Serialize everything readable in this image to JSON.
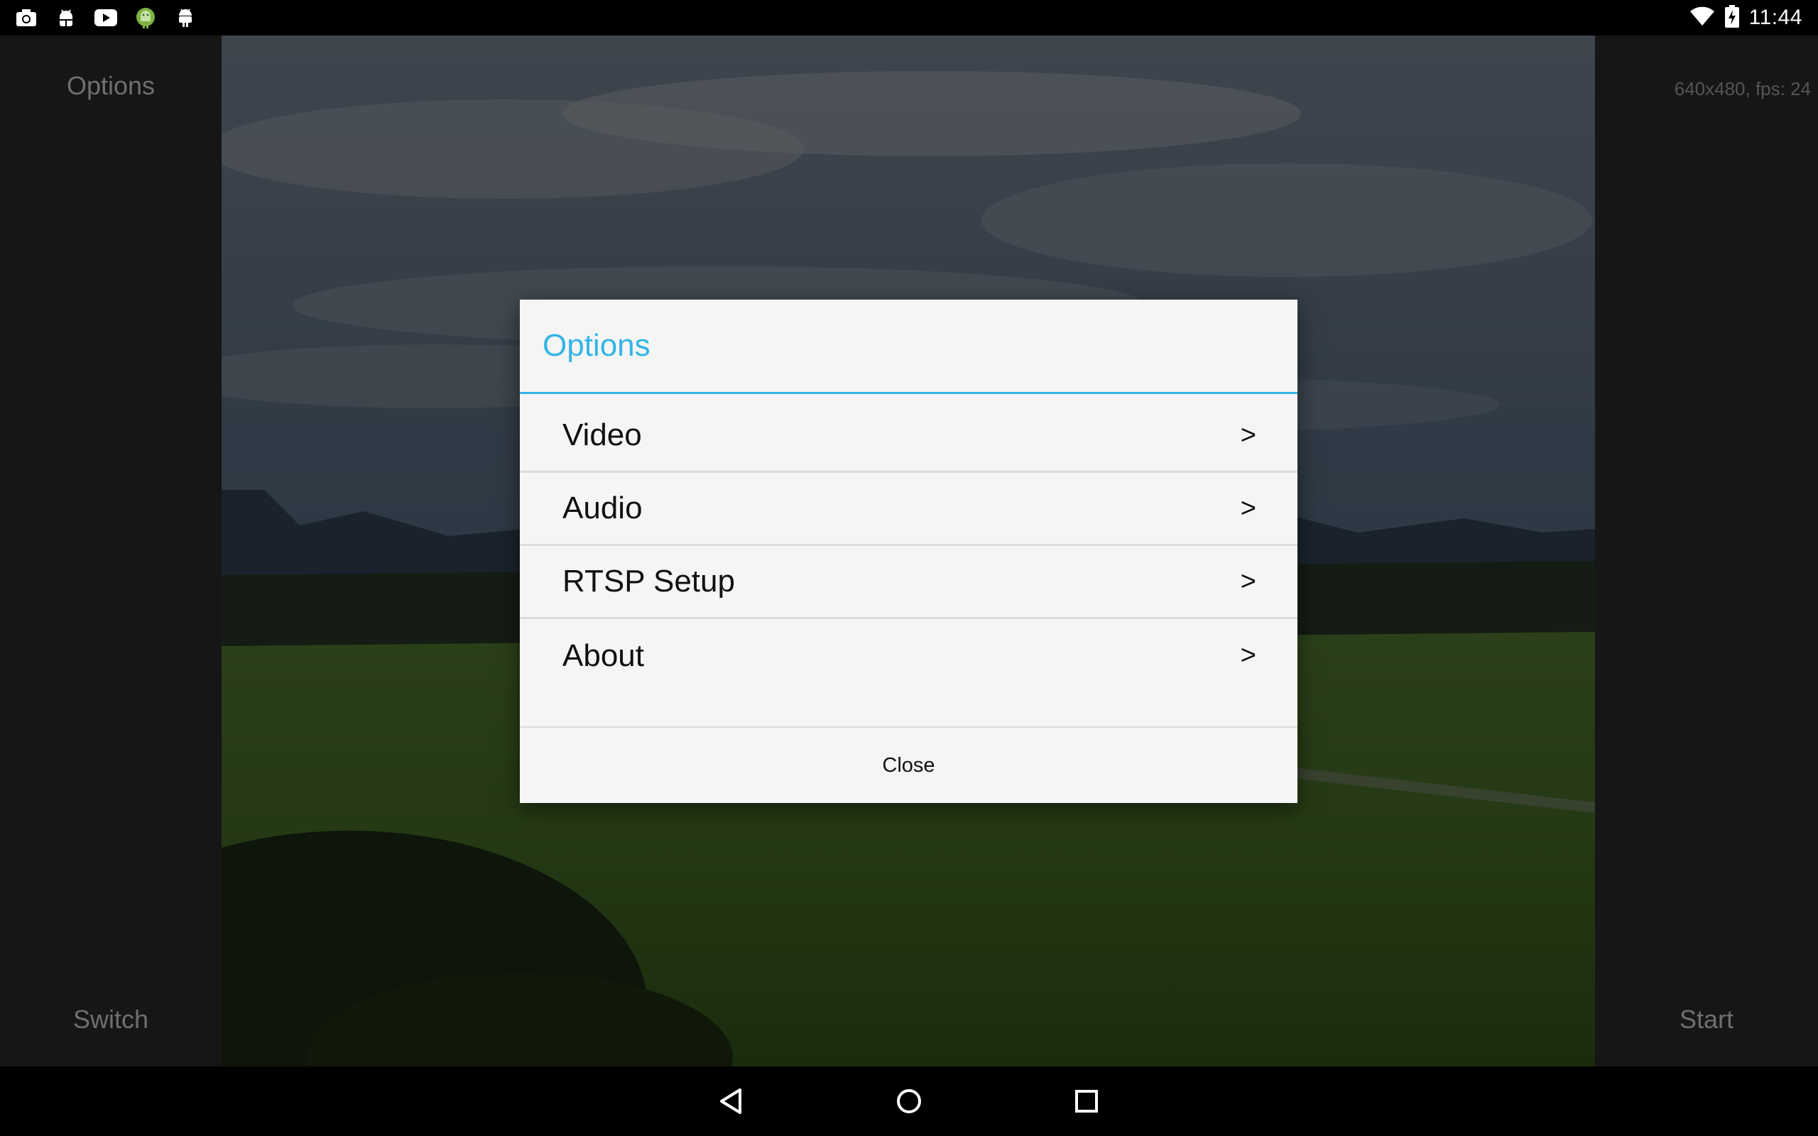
{
  "status_bar": {
    "time": "11:44",
    "left_icons": [
      "camera-icon",
      "android-debug-icon",
      "youtube-icon",
      "android-green-icon",
      "android-small-icon"
    ],
    "right_icons": [
      "wifi-icon",
      "battery-charging-icon"
    ]
  },
  "left_panel": {
    "options_label": "Options",
    "switch_label": "Switch"
  },
  "right_panel": {
    "resolution_info": "640x480, fps: 24",
    "start_label": "Start"
  },
  "dialog": {
    "title": "Options",
    "items": [
      {
        "label": "Video",
        "chevron": ">"
      },
      {
        "label": "Audio",
        "chevron": ">"
      },
      {
        "label": "RTSP Setup",
        "chevron": ">"
      },
      {
        "label": "About",
        "chevron": ">"
      }
    ],
    "close_label": "Close"
  },
  "nav_bar": {
    "buttons": [
      "back-icon",
      "home-icon",
      "recents-icon"
    ]
  },
  "colors": {
    "accent": "#33b5e5",
    "panel_bg": "#161616",
    "dialog_bg": "#f5f5f5"
  }
}
